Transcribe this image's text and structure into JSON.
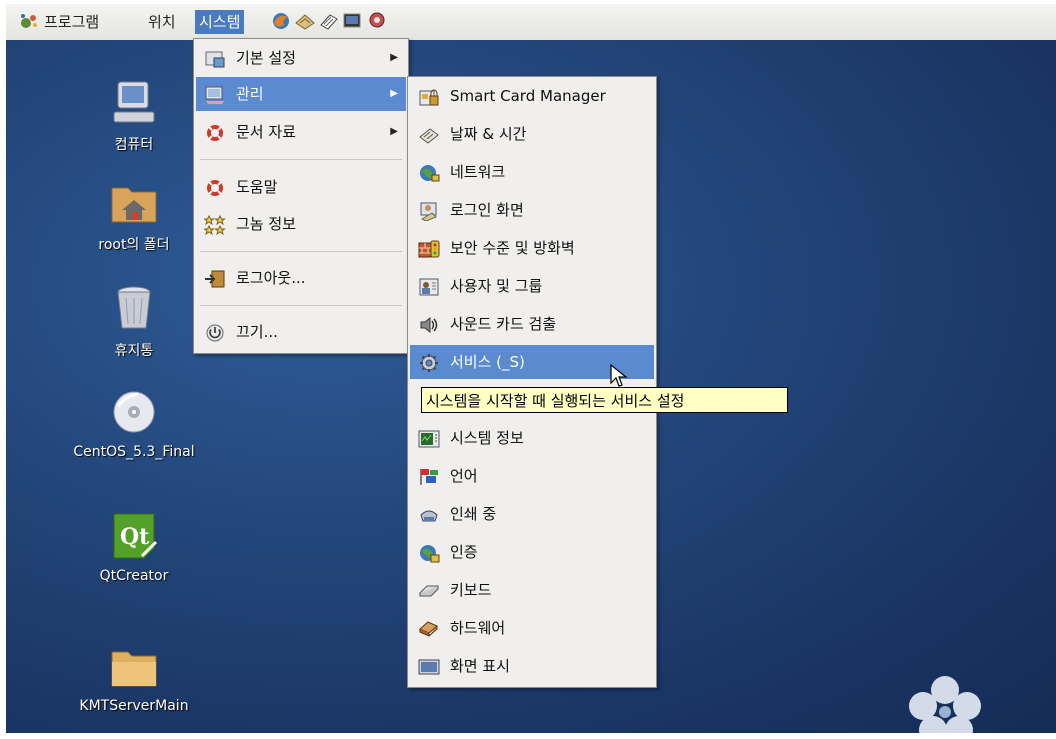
{
  "topbar": {
    "applications": "프로그램",
    "places": "위치",
    "system": "시스템",
    "launchers": [
      "firefox-icon",
      "evolution-icon",
      "text-editor-icon",
      "terminal-icon",
      "screenshot-icon"
    ]
  },
  "desktop_icons": [
    {
      "label": "컴퓨터",
      "icon": "computer-icon"
    },
    {
      "label": "root의 폴더",
      "icon": "home-folder-icon"
    },
    {
      "label": "휴지통",
      "icon": "trash-icon"
    },
    {
      "label": "CentOS_5.3_Final",
      "icon": "cdrom-icon"
    },
    {
      "label": "QtCreator",
      "icon": "qt-icon"
    },
    {
      "label": "KMTServerMain",
      "icon": "folder-icon"
    }
  ],
  "system_menu": {
    "preferences": "기본 설정",
    "administration": "관리",
    "documentation": "문서 자료",
    "help": "도움말",
    "about_gnome": "그놈 정보",
    "logout": "로그아웃...",
    "shutdown": "끄기..."
  },
  "admin_menu": [
    {
      "label": "Smart Card Manager",
      "icon": "smartcard-icon"
    },
    {
      "label": "날짜 & 시간",
      "icon": "clock-icon"
    },
    {
      "label": "네트워크",
      "icon": "network-icon"
    },
    {
      "label": "로그인 화면",
      "icon": "login-screen-icon"
    },
    {
      "label": "보안 수준 및 방화벽",
      "icon": "firewall-icon"
    },
    {
      "label": "사용자 및 그룹",
      "icon": "users-icon"
    },
    {
      "label": "사운드 카드 검출",
      "icon": "sound-icon"
    },
    {
      "label": "서비스 (_S)",
      "icon": "services-icon"
    },
    {
      "label": "시스템 정보",
      "icon": "system-info-icon"
    },
    {
      "label": "언어",
      "icon": "language-icon"
    },
    {
      "label": "인쇄 중",
      "icon": "printer-icon"
    },
    {
      "label": "인증",
      "icon": "authentication-icon"
    },
    {
      "label": "키보드",
      "icon": "keyboard-icon"
    },
    {
      "label": "하드웨어",
      "icon": "hardware-icon"
    },
    {
      "label": "화면 표시",
      "icon": "display-icon"
    }
  ],
  "tooltip": "시스템을 시작할 때 실행되는 서비스 설정",
  "colors": {
    "highlight": "#5a8ad0",
    "desktop": "#24497e",
    "tooltip_bg": "#ffffc4"
  }
}
